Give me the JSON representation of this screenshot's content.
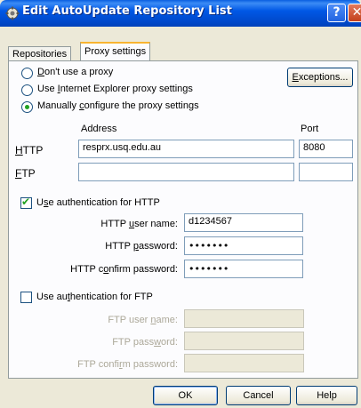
{
  "window": {
    "title": "Edit AutoUpdate Repository List"
  },
  "tabs": [
    {
      "label": "Repositories"
    },
    {
      "label": "Proxy settings"
    }
  ],
  "proxy": {
    "options": [
      {
        "pre": "",
        "acc": "D",
        "post": "on't use a proxy"
      },
      {
        "pre": "Use ",
        "acc": "I",
        "post": "nternet Explorer proxy settings"
      },
      {
        "pre": "Manually ",
        "acc": "c",
        "post": "onfigure the proxy settings"
      }
    ],
    "exceptions": {
      "acc": "E",
      "post": "xceptions..."
    },
    "address_header": "Address",
    "port_header": "Port",
    "http": {
      "acc": "H",
      "post": "TTP",
      "address": "resprx.usq.edu.au",
      "port": "8080"
    },
    "ftp": {
      "acc": "F",
      "post": "TP",
      "address": "",
      "port": ""
    }
  },
  "http_auth": {
    "label": {
      "pre": "U",
      "acc": "s",
      "post": "e authentication for HTTP"
    },
    "username": {
      "pre": "HTTP ",
      "acc": "u",
      "post": "ser name:",
      "value": "d1234567"
    },
    "password": {
      "pre": "HTTP ",
      "acc": "p",
      "post": "assword:",
      "value": "•••••••"
    },
    "confirm": {
      "pre": "HTTP c",
      "acc": "o",
      "post": "nfirm password:",
      "value": "•••••••"
    }
  },
  "ftp_auth": {
    "label": {
      "pre": "Use au",
      "acc": "t",
      "post": "hentication for FTP"
    },
    "username": {
      "pre": "FTP user ",
      "acc": "n",
      "post": "ame:",
      "value": ""
    },
    "password": {
      "pre": "FTP pass",
      "acc": "w",
      "post": "ord:",
      "value": ""
    },
    "confirm": {
      "pre": "FTP confi",
      "acc": "r",
      "post": "m password:",
      "value": ""
    }
  },
  "buttons": {
    "ok": "OK",
    "cancel": "Cancel",
    "help": "Help"
  },
  "titlebar_buttons": {
    "help": "?",
    "close": "✕"
  },
  "colors": {
    "titlebar": "#0058e6",
    "dialog": "#ece9d8",
    "check": "#21a121"
  }
}
